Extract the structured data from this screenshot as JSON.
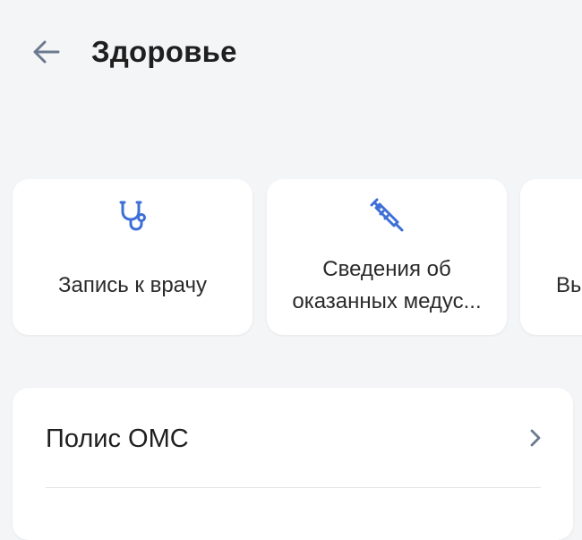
{
  "header": {
    "title": "Здоровье",
    "back_icon": "arrow-left-icon"
  },
  "services": [
    {
      "label": "Запись к врачу",
      "icon": "stethoscope-icon"
    },
    {
      "label": "Сведения об оказанных медус...",
      "icon": "syringe-icon"
    },
    {
      "label": "Вы",
      "icon": ""
    }
  ],
  "oms": {
    "title": "Полис ОМС",
    "chevron_icon": "chevron-right-icon"
  },
  "colors": {
    "accent": "#3d6fd6",
    "background": "#f4f5f7",
    "card": "#ffffff",
    "text": "#1f1f1f"
  }
}
